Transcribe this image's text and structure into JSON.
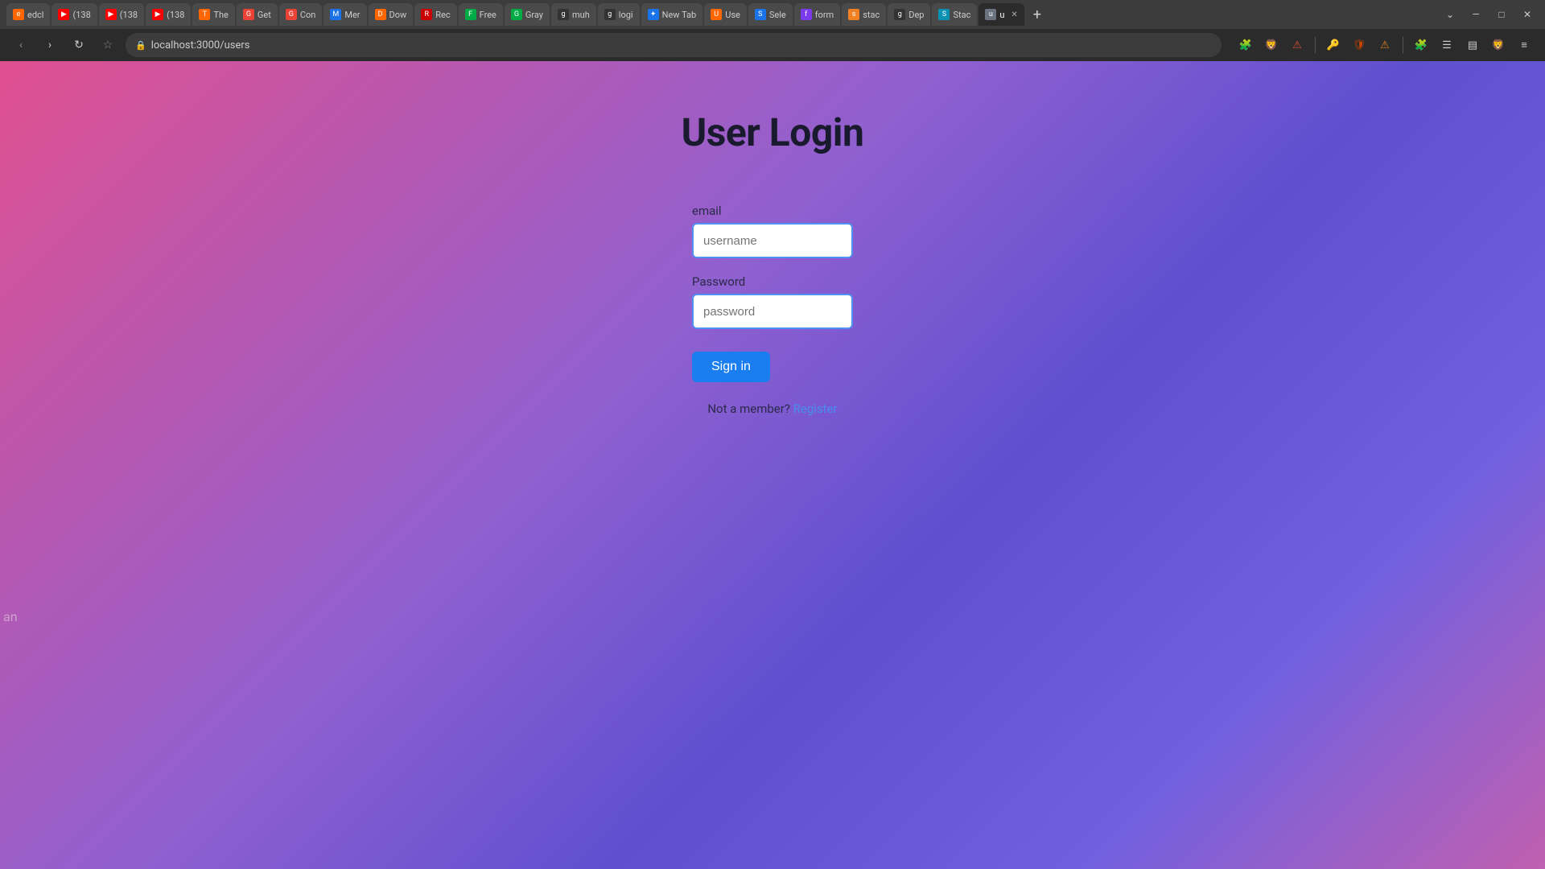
{
  "browser": {
    "url": "localhost:3000/users",
    "tabs": [
      {
        "id": "edcl",
        "label": "edcl",
        "favicon_color": "#cc4400",
        "active": false
      },
      {
        "id": "yt1",
        "label": "(138",
        "favicon_color": "#ff0000",
        "active": false
      },
      {
        "id": "yt2",
        "label": "(138",
        "favicon_color": "#ff0000",
        "active": false
      },
      {
        "id": "yt3",
        "label": "(138",
        "favicon_color": "#ff0000",
        "active": false
      },
      {
        "id": "the",
        "label": "The",
        "favicon_color": "#ff6600",
        "active": false
      },
      {
        "id": "gmail1",
        "label": "Get",
        "favicon_color": "#ea4335",
        "active": false
      },
      {
        "id": "gmail2",
        "label": "Con",
        "favicon_color": "#ea4335",
        "active": false
      },
      {
        "id": "mer",
        "label": "Mer",
        "favicon_color": "#4285f4",
        "active": false
      },
      {
        "id": "dow",
        "label": "Dow",
        "favicon_color": "#ff6600",
        "active": false
      },
      {
        "id": "rec",
        "label": "Rec",
        "favicon_color": "#cc0000",
        "active": false
      },
      {
        "id": "free1",
        "label": "Free",
        "favicon_color": "#00aa44",
        "active": false
      },
      {
        "id": "gray",
        "label": "Gray",
        "favicon_color": "#00aa44",
        "active": false
      },
      {
        "id": "muh",
        "label": "muh",
        "favicon_color": "#333",
        "active": false
      },
      {
        "id": "login",
        "label": "logi",
        "favicon_color": "#333",
        "active": false
      },
      {
        "id": "newtab",
        "label": "New Tab",
        "favicon_color": "#4285f4",
        "active": false
      },
      {
        "id": "use",
        "label": "Use",
        "favicon_color": "#ff6600",
        "active": false
      },
      {
        "id": "sel",
        "label": "Sele",
        "favicon_color": "#4285f4",
        "active": false
      },
      {
        "id": "form",
        "label": "form",
        "favicon_color": "#7c3aed",
        "active": false
      },
      {
        "id": "stack1",
        "label": "stac",
        "favicon_color": "#f48024",
        "active": false
      },
      {
        "id": "dep",
        "label": "Dep",
        "favicon_color": "#333",
        "active": false
      },
      {
        "id": "stac2",
        "label": "Stac",
        "favicon_color": "#0891b2",
        "active": false
      },
      {
        "id": "u",
        "label": "u",
        "favicon_color": "#6b7280",
        "active": true
      }
    ],
    "new_tab_label": "+",
    "nav": {
      "back_label": "‹",
      "forward_label": "›",
      "reload_label": "↻",
      "bookmark_label": "☆"
    },
    "window_controls": {
      "minimize": "—",
      "maximize": "□",
      "close": "✕"
    }
  },
  "page": {
    "title": "User Login",
    "form": {
      "email_label": "email",
      "email_placeholder": "username",
      "password_label": "Password",
      "password_placeholder": "password",
      "signin_button": "Sign in",
      "register_text": "Not a member?",
      "register_link": "Register"
    }
  },
  "bottom_left": {
    "text": "an"
  }
}
